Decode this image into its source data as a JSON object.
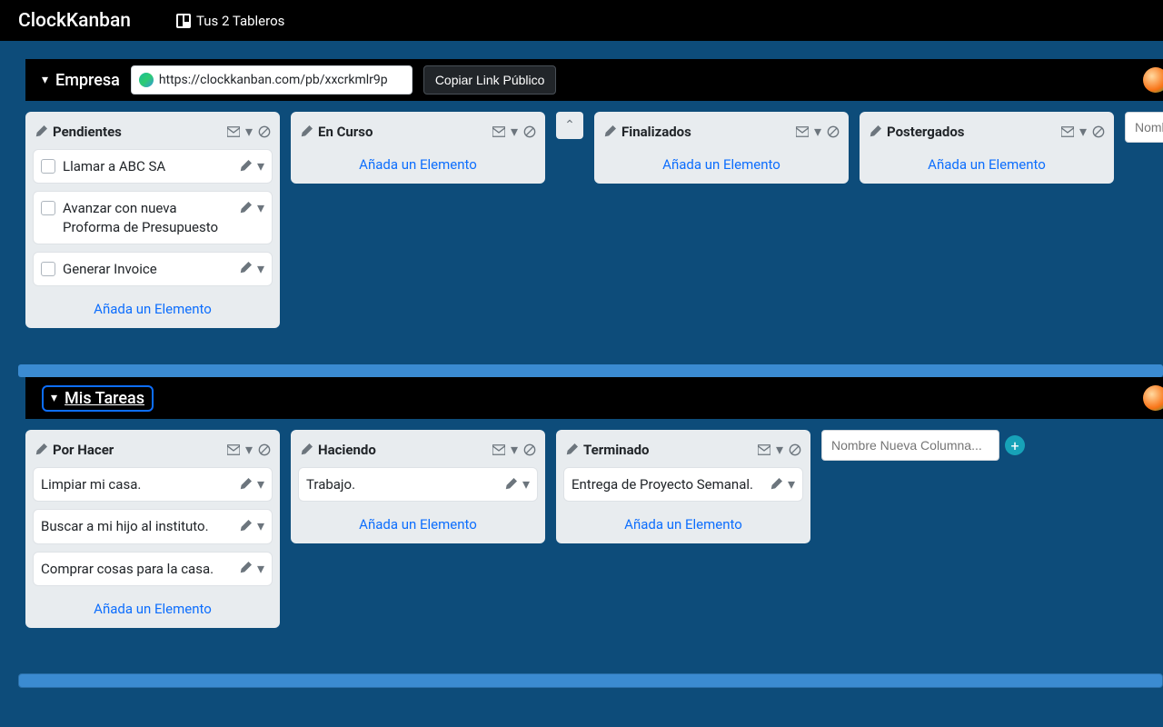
{
  "nav": {
    "brand": "ClockKanban",
    "boards_link": "Tus 2 Tableros"
  },
  "boards": [
    {
      "id": "empresa",
      "title": "Empresa",
      "public_url": "https://clockkanban.com/pb/xxcrkmlr9p",
      "copy_label": "Copiar Link Público",
      "show_url_bar": true,
      "selected": false,
      "columns": [
        {
          "title": "Pendientes",
          "add_label": "Añada un Elemento",
          "cards": [
            {
              "text": "Llamar a ABC SA",
              "checkbox": true
            },
            {
              "text": "Avanzar con nueva Proforma de Presupuesto",
              "checkbox": true
            },
            {
              "text": "Generar Invoice",
              "checkbox": true
            }
          ]
        },
        {
          "title": "En Curso",
          "add_label": "Añada un Elemento",
          "cards": []
        },
        {
          "collapsed": true
        },
        {
          "title": "Finalizados",
          "add_label": "Añada un Elemento",
          "cards": []
        },
        {
          "title": "Postergados",
          "add_label": "Añada un Elemento",
          "cards": []
        }
      ],
      "new_column_placeholder": "Nombre Nueva Columna..."
    },
    {
      "id": "mistareas",
      "title": "Mis Tareas",
      "show_url_bar": false,
      "selected": true,
      "columns": [
        {
          "title": "Por Hacer",
          "add_label": "Añada un Elemento",
          "cards": [
            {
              "text": "Limpiar mi casa.",
              "checkbox": false
            },
            {
              "text": "Buscar a mi hijo al instituto.",
              "checkbox": false
            },
            {
              "text": "Comprar cosas para la casa.",
              "checkbox": false
            }
          ]
        },
        {
          "title": "Haciendo",
          "add_label": "Añada un Elemento",
          "cards": [
            {
              "text": "Trabajo.",
              "checkbox": false
            }
          ]
        },
        {
          "title": "Terminado",
          "add_label": "Añada un Elemento",
          "cards": [
            {
              "text": "Entrega de Proyecto Semanal.",
              "checkbox": false
            }
          ]
        }
      ],
      "new_column_placeholder": "Nombre Nueva Columna..."
    }
  ]
}
